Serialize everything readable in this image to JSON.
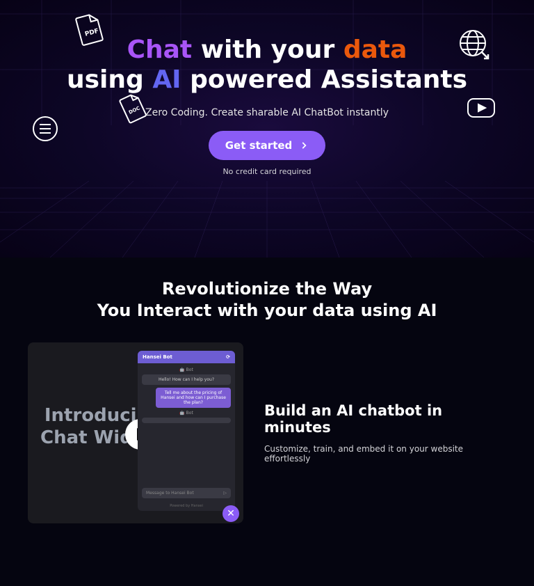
{
  "hero": {
    "title_p1": "Chat",
    "title_p2": "with your",
    "title_p3": "data",
    "title_p4": "using",
    "title_p5": "AI",
    "title_p6": "powered Assistants",
    "subheadline": "Zero Coding. Create sharable AI ChatBot instantly",
    "cta": "Get started",
    "note": "No credit card required"
  },
  "section2": {
    "title_l1": "Revolutionize the Way",
    "title_l2": "You Interact with your data using AI"
  },
  "preview": {
    "line1": "Introducing",
    "line2": "Chat Widget"
  },
  "chat": {
    "header": "Hansei Bot",
    "bot_label": "Bot",
    "msg1": "Hello! How can I help you?",
    "msg2": "Tell me about the pricing of Hansei and how can I purchase the plan?",
    "input_placeholder": "Message to Hansei Bot",
    "footer": "Powered by Hansei"
  },
  "feature": {
    "title": "Build an AI chatbot in minutes",
    "desc": "Customize, train, and embed it on your website effortlessly"
  }
}
